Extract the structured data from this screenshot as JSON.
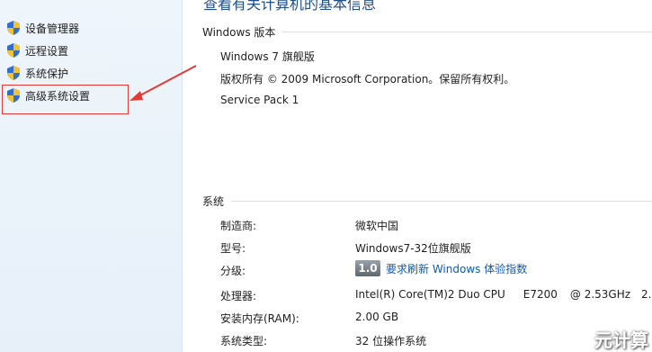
{
  "sidebar": {
    "items": [
      {
        "label": "设备管理器",
        "icon": "shield-icon"
      },
      {
        "label": "远程设置",
        "icon": "shield-icon"
      },
      {
        "label": "系统保护",
        "icon": "shield-icon"
      },
      {
        "label": "高级系统设置",
        "icon": "shield-icon"
      }
    ]
  },
  "main": {
    "title": "查看有关计算机的基本信息",
    "windows_section": {
      "header": "Windows 版本",
      "edition": "Windows 7 旗舰版",
      "copyright": "版权所有 © 2009 Microsoft Corporation。保留所有权利。",
      "service_pack": "Service Pack 1"
    },
    "system_section": {
      "header": "系统",
      "rows": [
        {
          "label": "制造商:",
          "value": "微软中国"
        },
        {
          "label": "型号:",
          "value": "Windows7-32位旗舰版"
        },
        {
          "label": "分级:",
          "score": "1.0",
          "link": "要求刷新 Windows 体验指数"
        },
        {
          "label": "处理器:",
          "cpu_model": "Intel(R) Core(TM)2 Duo CPU",
          "cpu_id": "E7200",
          "cpu_speed": "@ 2.53GHz",
          "cpu_extra": "2.53"
        },
        {
          "label": "安装内存(RAM):",
          "value": "2.00 GB"
        },
        {
          "label": "系统类型:",
          "value": "32 位操作系统"
        }
      ]
    }
  },
  "annotation_color": "#e53935",
  "link_color": "#0b5bb5",
  "watermark": "元计算"
}
